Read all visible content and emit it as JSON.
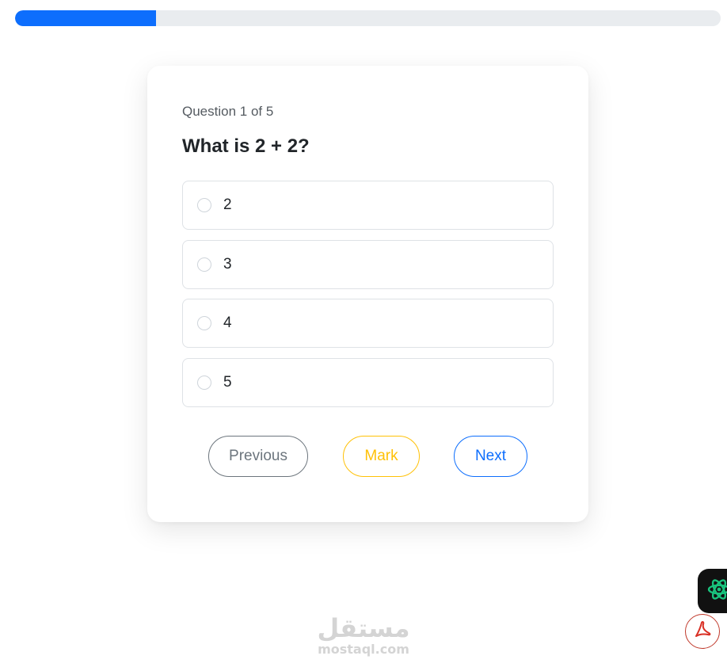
{
  "progress": {
    "value": 0.2,
    "fill_color": "#0d6efd",
    "track_color": "#e9ecef"
  },
  "quiz": {
    "counter": "Question 1 of 5",
    "question": "What is 2 + 2?",
    "options": [
      {
        "label": "2",
        "selected": false
      },
      {
        "label": "3",
        "selected": false
      },
      {
        "label": "4",
        "selected": false
      },
      {
        "label": "5",
        "selected": false
      }
    ]
  },
  "actions": {
    "previous_label": "Previous",
    "mark_label": "Mark",
    "next_label": "Next",
    "colors": {
      "previous": "#6c757d",
      "mark": "#ffc107",
      "next": "#0d6efd"
    }
  },
  "floating": {
    "ai_icon": "atom-icon",
    "pdf_icon": "acrobat-pdf-icon"
  },
  "watermark": {
    "arabic": "مستقل",
    "latin": "mostaql.com"
  }
}
